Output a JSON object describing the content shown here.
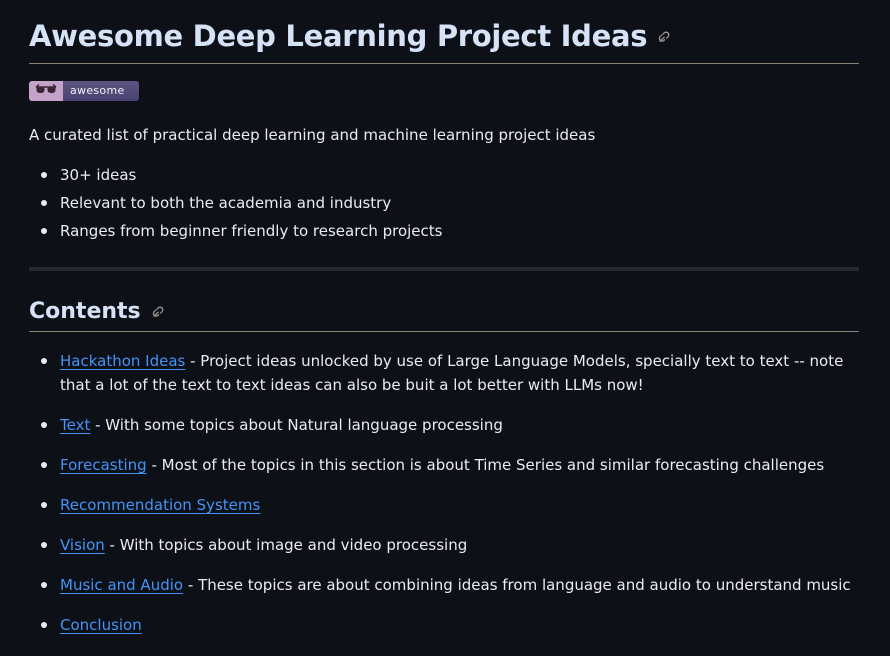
{
  "title": "Awesome Deep Learning Project Ideas",
  "badge": {
    "icon": "sunglasses-icon",
    "label": "awesome",
    "left_color": "#c5a3c9",
    "right_color": "#544a7a"
  },
  "intro": "A curated list of practical deep learning and machine learning project ideas",
  "features": [
    "30+ ideas",
    "Relevant to both the academia and industry",
    "Ranges from beginner friendly to research projects"
  ],
  "contents_heading": "Contents",
  "contents": [
    {
      "link": "Hackathon Ideas",
      "desc": " - Project ideas unlocked by use of Large Language Models, specially text to text -- note that a lot of the text to text ideas can also be buit a lot better with LLMs now!"
    },
    {
      "link": "Text",
      "desc": " - With some topics about Natural language processing"
    },
    {
      "link": "Forecasting",
      "desc": " - Most of the topics in this section is about Time Series and similar forecasting challenges"
    },
    {
      "link": "Recommendation Systems",
      "desc": ""
    },
    {
      "link": "Vision",
      "desc": " - With topics about image and video processing"
    },
    {
      "link": "Music and Audio",
      "desc": " - These topics are about combining ideas from language and audio to understand music"
    },
    {
      "link": "Conclusion",
      "desc": ""
    }
  ],
  "colors": {
    "background": "#0d1117",
    "text": "#e6edf3",
    "heading": "#d6e3f7",
    "link": "#4493f8",
    "rule": "#8b8178"
  }
}
